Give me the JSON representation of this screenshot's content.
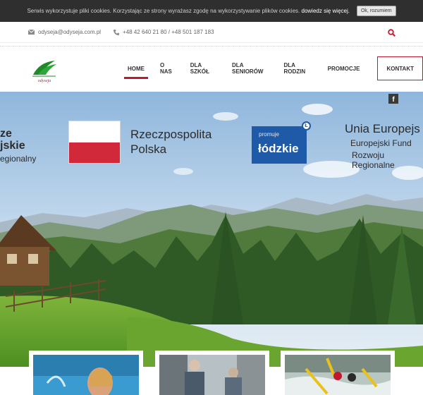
{
  "cookie": {
    "text": "Serwis wykorzystuje pliki cookies. Korzystając ze strony wyrażasz zgodę na wykorzystywanie plików cookies.",
    "link": "dowiedz się więcej.",
    "button": "Ok, rozumiem"
  },
  "contact": {
    "email": "odyseja@odyseja.com.pl",
    "phone": "+48 42 640 21 80 / +48 501 187 183",
    "email_icon": "envelope-icon",
    "phone_icon": "phone-icon",
    "search_icon": "search-icon"
  },
  "logo": {
    "text": "odyseja"
  },
  "nav": {
    "home": "HOME",
    "about": "O NAS",
    "schools": "DLA SZKÓŁ",
    "seniors": "DLA SENIORÓW",
    "families": "DLA RODZIN",
    "promotions": "PROMOCJE",
    "contact": "KONTAKT"
  },
  "hero": {
    "left_line1": "ze",
    "left_line2": "jskie",
    "left_line3": "egionalny",
    "rp_line1": "Rzeczpospolita",
    "rp_line2": "Polska",
    "lodz_small": "promuje",
    "lodz_big": "łódzkie",
    "ue_line1": "Unia Europejs",
    "ue_line2": "Europejski Fund",
    "ue_line3": "Rozwoju Regionalne",
    "facebook_icon": "facebook-icon"
  },
  "colors": {
    "accent": "#c0182f",
    "cookie_bg": "#2f2f2f",
    "lodz_blue": "#1e5aa8",
    "logo_green": "#1f8a2a"
  }
}
